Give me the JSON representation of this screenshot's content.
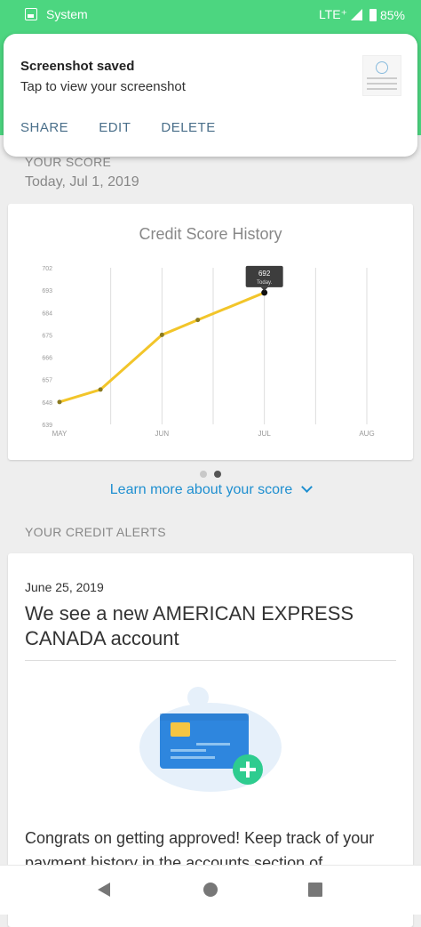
{
  "status_bar": {
    "app_name": "System",
    "network": "LTE⁺",
    "battery": "85%"
  },
  "notification": {
    "title": "Screenshot saved",
    "subtitle": "Tap to view your screenshot",
    "actions": [
      "SHARE",
      "EDIT",
      "DELETE"
    ],
    "thumb_score": "692"
  },
  "score": {
    "label": "YOUR SCORE",
    "date": "Today, Jul 1, 2019"
  },
  "chart_data": {
    "type": "line",
    "title": "Credit Score History",
    "x_ticks": [
      "MAY",
      "JUN",
      "JUL",
      "AUG"
    ],
    "y_ticks": [
      639,
      648,
      657,
      666,
      675,
      684,
      693,
      702
    ],
    "ylim": [
      639,
      702
    ],
    "xlim": [
      0,
      3
    ],
    "grid": true,
    "color": "#f2c52a",
    "points": [
      {
        "x": 0.0,
        "y": 648
      },
      {
        "x": 0.4,
        "y": 653
      },
      {
        "x": 1.0,
        "y": 675
      },
      {
        "x": 1.35,
        "y": 681
      },
      {
        "x": 2.0,
        "y": 692
      }
    ],
    "tooltip": {
      "value": "692",
      "label": "Today."
    }
  },
  "pager": {
    "count": 2,
    "active": 1
  },
  "learn_more": "Learn more about your score",
  "alerts_label": "YOUR CREDIT ALERTS",
  "alert": {
    "date": "June 25, 2019",
    "title": "We see a new AMERICAN EXPRESS CANADA account",
    "body": "Congrats on getting approved! Keep track of your payment history in the accounts section of"
  },
  "colors": {
    "brand_green": "#4cd680",
    "link_blue": "#1e8fd0",
    "line_yellow": "#f2c52a"
  }
}
